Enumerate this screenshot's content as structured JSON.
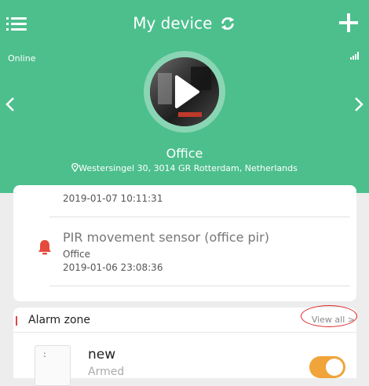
{
  "header": {
    "title": "My device",
    "status": "Online",
    "device_name": "Office",
    "address": "Westersingel 30, 3014 GR Rotterdam, Netherlands",
    "background_color": "#4cbf8d"
  },
  "events": [
    {
      "date": "2019-01-07 10:11:31"
    },
    {
      "title": "PIR movement sensor (office pir)",
      "location": "Office",
      "date": "2019-01-06 23:08:36",
      "icon": "bell-icon",
      "icon_color": "#e64a3c"
    }
  ],
  "alarm_zone": {
    "label": "Alarm zone",
    "view_all": "View all >",
    "devices": [
      {
        "name": "new",
        "state": "Armed",
        "image_text": ":",
        "toggle_on": true,
        "toggle_color": "#f0a43a"
      }
    ]
  }
}
